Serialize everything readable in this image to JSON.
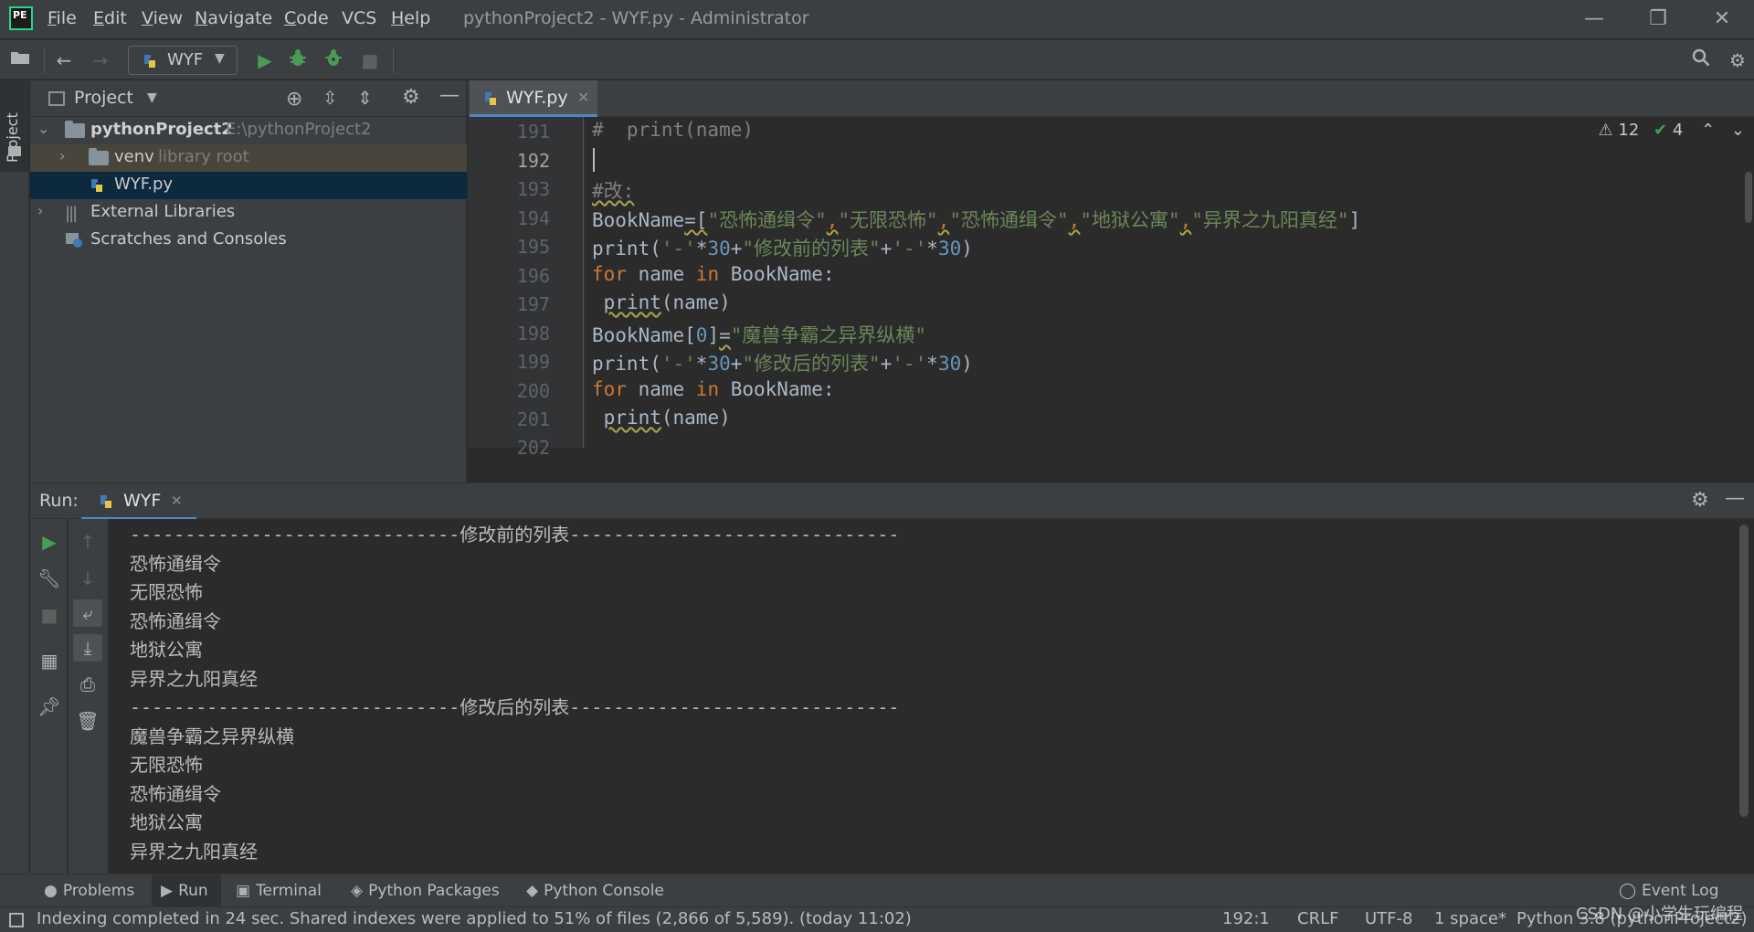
{
  "window": {
    "title": "pythonProject2 - WYF.py - Administrator",
    "app_icon": "pycharm-logo",
    "app_icon_text": "PE"
  },
  "menu": {
    "items": [
      {
        "label": "File",
        "mnemonic": "F",
        "rest": "ile"
      },
      {
        "label": "Edit",
        "mnemonic": "E",
        "rest": "dit"
      },
      {
        "label": "View",
        "mnemonic": "V",
        "rest": "iew"
      },
      {
        "label": "Navigate",
        "mnemonic": "N",
        "rest": "avigate"
      },
      {
        "label": "Code",
        "mnemonic": "C",
        "rest": "ode"
      },
      {
        "label": "VCS",
        "mnemonic": "",
        "rest": "VCS"
      },
      {
        "label": "Help",
        "mnemonic": "H",
        "rest": "elp"
      }
    ]
  },
  "toolbar": {
    "run_config": "WYF"
  },
  "left_stripe": {
    "project_label": "Project"
  },
  "project_panel": {
    "title": "Project",
    "tree": [
      {
        "label": "pythonProject2",
        "sub": "E:\\pythonProject2"
      },
      {
        "label": "venv",
        "sub": "library root"
      },
      {
        "label": "WYF.py",
        "sub": ""
      },
      {
        "label": "External Libraries",
        "sub": ""
      },
      {
        "label": "Scratches and Consoles",
        "sub": ""
      }
    ]
  },
  "editor": {
    "tab_label": "WYF.py",
    "warnings_count": "12",
    "weak_warnings_count": "4",
    "line_numbers": [
      "191",
      "192",
      "193",
      "194",
      "195",
      "196",
      "197",
      "198",
      "199",
      "200",
      "201",
      "202"
    ],
    "lines": {
      "l191": "#  print(name)",
      "l193": "#改:",
      "l194_a": "BookName",
      "l194_b": "=[",
      "l194_c": "\"恐怖通缉令\"",
      "l194_d": "\"无限恐怖\"",
      "l194_e": "\"恐怖通缉令\"",
      "l194_f": "\"地狱公寓\"",
      "l194_g": "\"异界之九阳真经\"",
      "l194_h": "]",
      "l195_a": "print(",
      "l195_b": "'-'",
      "l195_c": "*",
      "l195_d": "30",
      "l195_e": "+",
      "l195_f": "\"修改前的列表\"",
      "l195_g": "+",
      "l195_h": "'-'",
      "l195_i": "*",
      "l195_j": "30",
      "l195_k": ")",
      "l196_a": "for",
      "l196_b": " name ",
      "l196_c": "in",
      "l196_d": " BookName:",
      "l197_a": "print",
      "l197_b": "(name)",
      "l198_a": "BookName[",
      "l198_b": "0",
      "l198_c": "]",
      "l198_d": "=",
      "l198_e": "\"魔兽争霸之异界纵横\"",
      "l199_a": "print(",
      "l199_b": "'-'",
      "l199_c": "*",
      "l199_d": "30",
      "l199_e": "+",
      "l199_f": "\"修改后的列表\"",
      "l199_g": "+",
      "l199_h": "'-'",
      "l199_i": "*",
      "l199_j": "30",
      "l199_k": ")",
      "l200_a": "for",
      "l200_b": " name ",
      "l200_c": "in",
      "l200_d": " BookName:",
      "l201_a": "print",
      "l201_b": "(name)"
    }
  },
  "run_panel": {
    "label": "Run:",
    "tab_label": "WYF",
    "output": [
      "------------------------------修改前的列表------------------------------",
      "恐怖通缉令",
      "无限恐怖",
      "恐怖通缉令",
      "地狱公寓",
      "异界之九阳真经",
      "------------------------------修改后的列表------------------------------",
      "魔兽争霸之异界纵横",
      "无限恐怖",
      "恐怖通缉令",
      "地狱公寓",
      "异界之九阳真经"
    ]
  },
  "bottom_tabs": {
    "problems": "Problems",
    "run": "Run",
    "terminal": "Terminal",
    "python_packages": "Python Packages",
    "python_console": "Python Console",
    "event_log": "Event Log"
  },
  "status_bar": {
    "message": "Indexing completed in 24 sec. Shared indexes were applied to 51% of files (2,866 of 5,589). (today 11:02)",
    "position": "192:1",
    "line_sep": "CRLF",
    "encoding": "UTF-8",
    "indent": "1 space*",
    "interpreter": "Python 3.8 (pythonProject2)"
  },
  "watermark": "CSDN @小学生玩编程",
  "colors": {
    "accent": "#4a88c7",
    "run_green": "#499c54",
    "keyword": "#cc7832",
    "string": "#6a8759",
    "number": "#6897bb",
    "comment": "#808080"
  }
}
